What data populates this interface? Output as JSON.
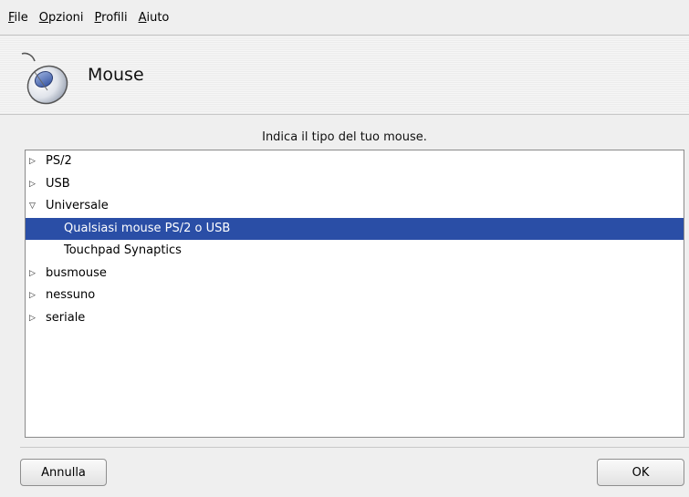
{
  "menubar": {
    "items": [
      {
        "accel": "F",
        "rest": "ile"
      },
      {
        "accel": "O",
        "rest": "pzioni"
      },
      {
        "accel": "P",
        "rest": "rofili"
      },
      {
        "accel": "A",
        "rest": "iuto"
      }
    ]
  },
  "header": {
    "title": "Mouse",
    "icon": "mouse-icon"
  },
  "prompt": "Indica il tipo del tuo mouse.",
  "tree": {
    "items": [
      {
        "label": "PS/2",
        "expander": "▷"
      },
      {
        "label": "USB",
        "expander": "▷"
      },
      {
        "label": "Universale",
        "expander": "▽"
      },
      {
        "label": "Qualsiasi mouse PS/2 o USB",
        "selected": true
      },
      {
        "label": "Touchpad Synaptics"
      },
      {
        "label": "busmouse",
        "expander": "▷"
      },
      {
        "label": "nessuno",
        "expander": "▷"
      },
      {
        "label": "seriale",
        "expander": "▷"
      }
    ]
  },
  "buttons": {
    "cancel": "Annulla",
    "ok": "OK"
  },
  "colors": {
    "selection": "#2a4ea6",
    "background": "#efefef"
  }
}
